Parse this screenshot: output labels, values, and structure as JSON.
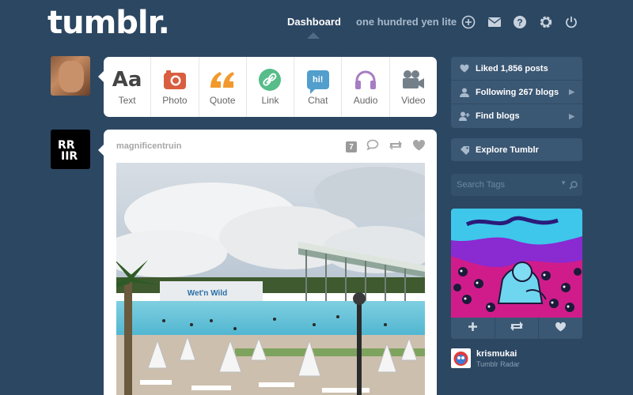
{
  "app": {
    "logo": "tumblr."
  },
  "nav": {
    "dashboard": "Dashboard",
    "blog_name": "one hundred yen lite",
    "icons": [
      "plus-circle-icon",
      "mail-icon",
      "help-icon",
      "gear-icon",
      "power-icon"
    ]
  },
  "composer": {
    "items": [
      {
        "label": "Text",
        "glyph": "Aa",
        "icon": "text-icon",
        "color": "#444444"
      },
      {
        "label": "Photo",
        "icon": "camera-icon",
        "color": "#d95e40"
      },
      {
        "label": "Quote",
        "glyph": "“",
        "icon": "quote-icon",
        "color": "#f2992e"
      },
      {
        "label": "Link",
        "icon": "link-icon",
        "color": "#56bc8a"
      },
      {
        "label": "Chat",
        "glyph": "hi!",
        "icon": "chat-icon",
        "color": "#529ecc"
      },
      {
        "label": "Audio",
        "icon": "headphones-icon",
        "color": "#a77dc2"
      },
      {
        "label": "Video",
        "icon": "video-camera-icon",
        "color": "#748089"
      }
    ]
  },
  "post": {
    "author": "magnificentruin",
    "note_count": "7",
    "photo_sign": "Wet'n Wild"
  },
  "sidebar": {
    "liked": "Liked 1,856 posts",
    "following": "Following 267 blogs",
    "find": "Find blogs",
    "explore": "Explore Tumblr",
    "search_placeholder": "Search Tags"
  },
  "radar": {
    "username": "krismukai",
    "subtitle": "Tumblr Radar"
  },
  "colors": {
    "background": "#2c4762",
    "panel": "#3a5773"
  }
}
